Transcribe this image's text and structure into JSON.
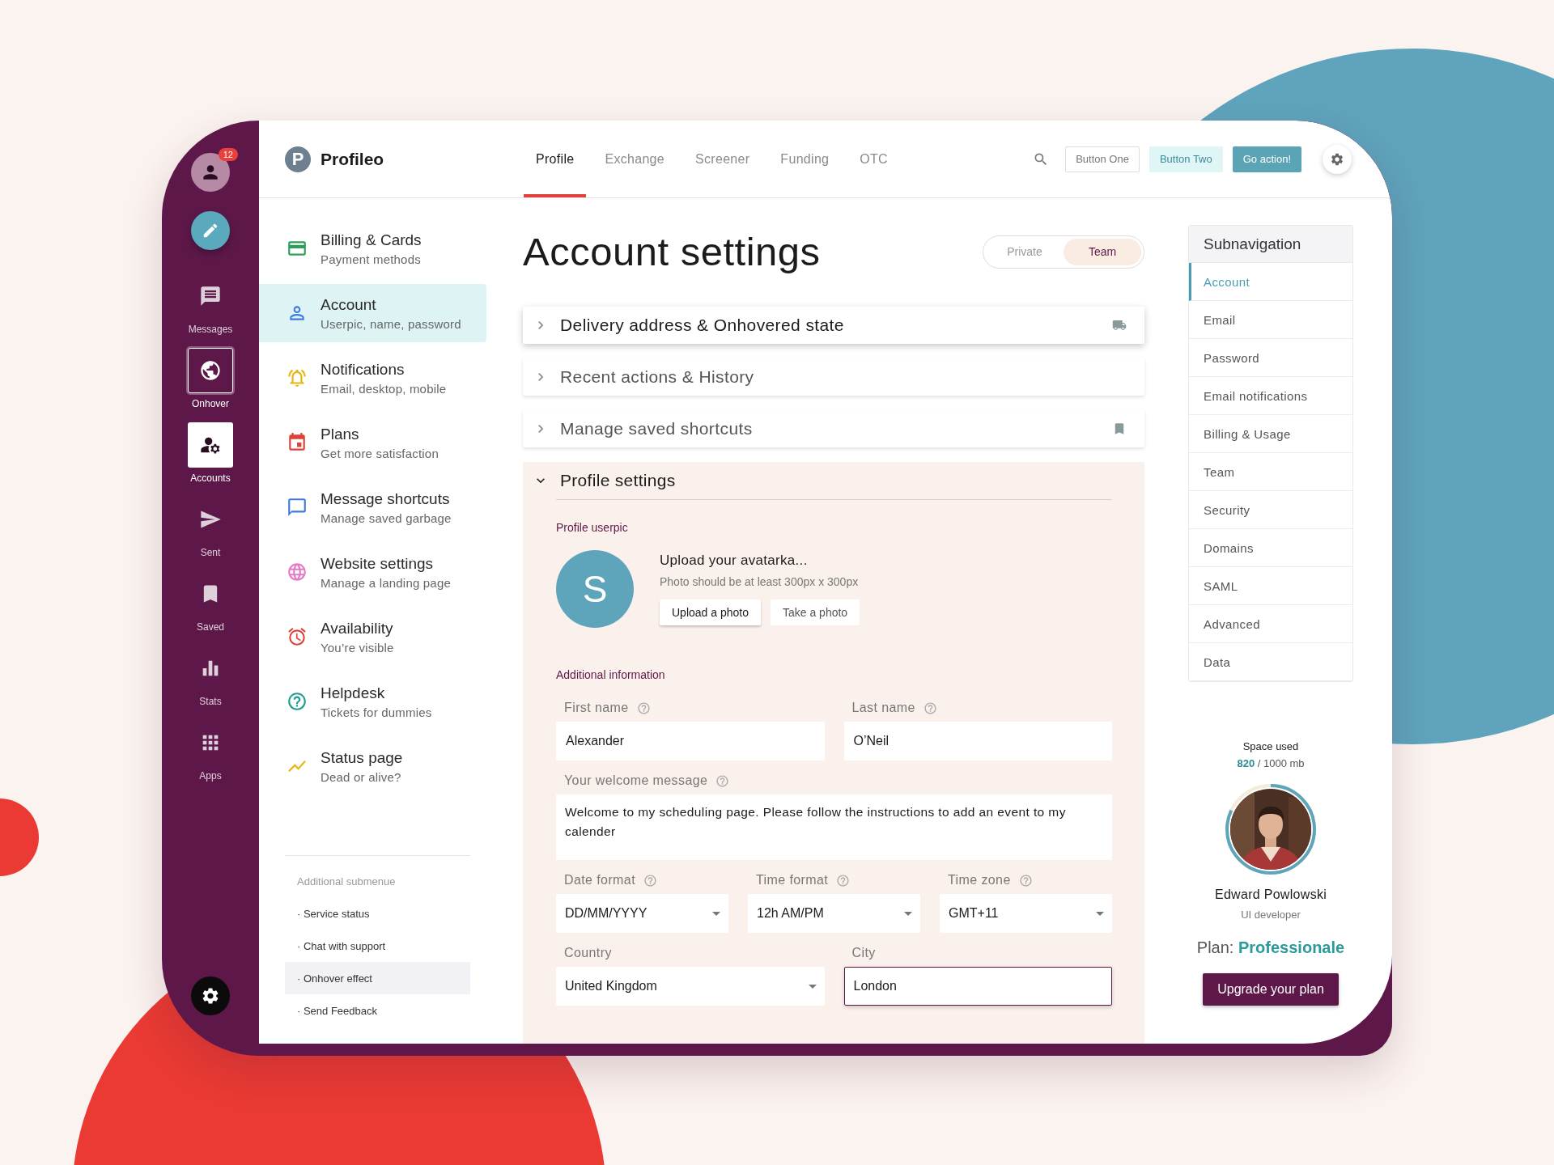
{
  "rail": {
    "badge": "12",
    "items": [
      {
        "label": "Messages",
        "selected": false,
        "hovered": false
      },
      {
        "label": "Onhover",
        "selected": false,
        "hovered": true
      },
      {
        "label": "Accounts",
        "selected": true,
        "hovered": false
      },
      {
        "label": "Sent",
        "selected": false,
        "hovered": false
      },
      {
        "label": "Saved",
        "selected": false,
        "hovered": false
      },
      {
        "label": "Stats",
        "selected": false,
        "hovered": false
      },
      {
        "label": "Apps",
        "selected": false,
        "hovered": false
      }
    ]
  },
  "brand": {
    "letter": "P",
    "name": "Profileo"
  },
  "tabs": [
    {
      "label": "Profile",
      "selected": true
    },
    {
      "label": "Exchange",
      "selected": false
    },
    {
      "label": "Screener",
      "selected": false
    },
    {
      "label": "Funding",
      "selected": false
    },
    {
      "label": "OTC",
      "selected": false
    }
  ],
  "toolbar_buttons": [
    {
      "label": "Button One",
      "kind": "outline"
    },
    {
      "label": "Button Two",
      "kind": "soft"
    },
    {
      "label": "Go action!",
      "kind": "primary"
    }
  ],
  "menu": {
    "items": [
      {
        "title": "Billing & Cards",
        "subtitle": "Payment methods",
        "color": "#2e9e5b",
        "selected": false
      },
      {
        "title": "Account",
        "subtitle": "Userpic, name, password",
        "color": "#3d7be0",
        "selected": true
      },
      {
        "title": "Notifications",
        "subtitle": "Email, desktop, mobile",
        "color": "#e8b417",
        "selected": false
      },
      {
        "title": "Plans",
        "subtitle": "Get more satisfaction",
        "color": "#e0413a",
        "selected": false
      },
      {
        "title": "Message shortcuts",
        "subtitle": "Manage saved garbage",
        "color": "#3d7be0",
        "selected": false
      },
      {
        "title": "Website settings",
        "subtitle": "Manage a landing page",
        "color": "#e77ac6",
        "selected": false
      },
      {
        "title": "Availability",
        "subtitle": "You’re visible",
        "color": "#e0413a",
        "selected": false
      },
      {
        "title": "Helpdesk",
        "subtitle": "Tickets for dummies",
        "color": "#1d9d8f",
        "selected": false
      },
      {
        "title": "Status page",
        "subtitle": "Dead or alive?",
        "color": "#e8b417",
        "selected": false
      }
    ],
    "submenu": {
      "title": "Additional submenue",
      "items": [
        {
          "label": "· Service status",
          "hovered": false
        },
        {
          "label": "· Chat with support",
          "hovered": false
        },
        {
          "label": "· Onhover effect",
          "hovered": true
        },
        {
          "label": "· Send Feedback",
          "hovered": false
        }
      ]
    }
  },
  "page": {
    "title": "Account settings",
    "toggle": [
      {
        "label": "Private",
        "selected": false
      },
      {
        "label": "Team",
        "selected": true
      }
    ]
  },
  "accordions": [
    {
      "title": "Delivery address & Onhovered state",
      "expanded": false,
      "hovered": true
    },
    {
      "title": "Recent actions & History",
      "expanded": false,
      "hovered": false
    },
    {
      "title": "Manage saved shortcuts",
      "expanded": false,
      "hovered": false
    }
  ],
  "profile": {
    "title": "Profile settings",
    "expanded": true,
    "userpic_label": "Profile userpic",
    "avatar_letter": "S",
    "upload_title": "Upload your avatarka...",
    "upload_hint": "Photo should be at least 300px x 300px",
    "buttons": [
      {
        "label": "Upload a photo",
        "kind": "raised"
      },
      {
        "label": "Take a photo",
        "kind": "flat"
      }
    ],
    "additional_label": "Additional information",
    "field_rows": [
      [
        {
          "label": "First name",
          "value": "Alexander",
          "kind": "text",
          "help": true,
          "focused": false
        },
        {
          "label": "Last name",
          "value": "O’Neil",
          "kind": "text",
          "help": true,
          "focused": false
        }
      ],
      [
        {
          "label": "Your welcome message",
          "value": "Welcome to my scheduling page. Please follow the instructions to add an event to my calender",
          "kind": "textarea",
          "help": true,
          "focused": false
        }
      ],
      [
        {
          "label": "Date format",
          "value": "DD/MM/YYYY",
          "kind": "select",
          "help": true,
          "focused": false
        },
        {
          "label": "Time format",
          "value": "12h AM/PM",
          "kind": "select",
          "help": true,
          "focused": false
        },
        {
          "label": "Time zone",
          "value": "GMT+11",
          "kind": "select",
          "help": true,
          "focused": false
        }
      ],
      [
        {
          "label": "Country",
          "value": "United Kingdom",
          "kind": "select",
          "help": false,
          "focused": false
        },
        {
          "label": "City",
          "value": "London",
          "kind": "text",
          "help": false,
          "focused": true
        }
      ]
    ]
  },
  "subnav": {
    "title": "Subnavigation",
    "items": [
      {
        "label": "Account",
        "selected": true
      },
      {
        "label": "Email",
        "selected": false
      },
      {
        "label": "Password",
        "selected": false
      },
      {
        "label": "Email notifications",
        "selected": false
      },
      {
        "label": "Billing & Usage",
        "selected": false
      },
      {
        "label": "Team",
        "selected": false
      },
      {
        "label": "Security",
        "selected": false
      },
      {
        "label": "Domains",
        "selected": false
      },
      {
        "label": "SAML",
        "selected": false
      },
      {
        "label": "Advanced",
        "selected": false
      },
      {
        "label": "Data",
        "selected": false
      }
    ]
  },
  "storage": {
    "title": "Space used",
    "used": "820",
    "total": "/ 1000 mb"
  },
  "user": {
    "name": "Edward Powlowski",
    "role": "UI developer"
  },
  "plan": {
    "label": "Plan:",
    "name": "Professionale"
  },
  "upgrade_button": "Upgrade your plan"
}
